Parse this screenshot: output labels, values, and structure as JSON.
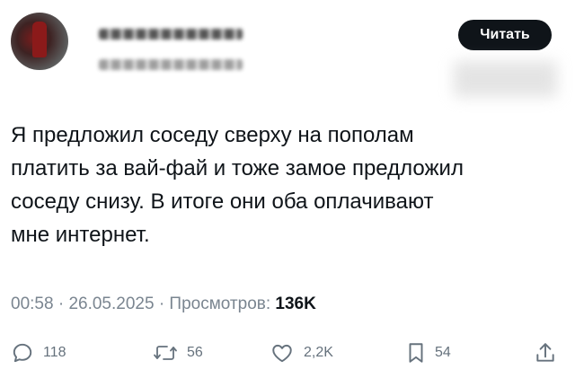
{
  "header": {
    "read_button_label": "Читать"
  },
  "tweet": {
    "text": "Я предложил соседу сверху на пополам\nплатить за вай-фай и тоже замое предложил\nсоседу снизу. В итоге они оба оплачивают\nмне интернет.",
    "time": "00:58",
    "separator": "·",
    "date": "26.05.2025",
    "views_label": "Просмотров:",
    "views_count": "136K"
  },
  "actions": {
    "replies": "118",
    "retweets": "56",
    "likes": "2,2K",
    "bookmarks": "54"
  }
}
